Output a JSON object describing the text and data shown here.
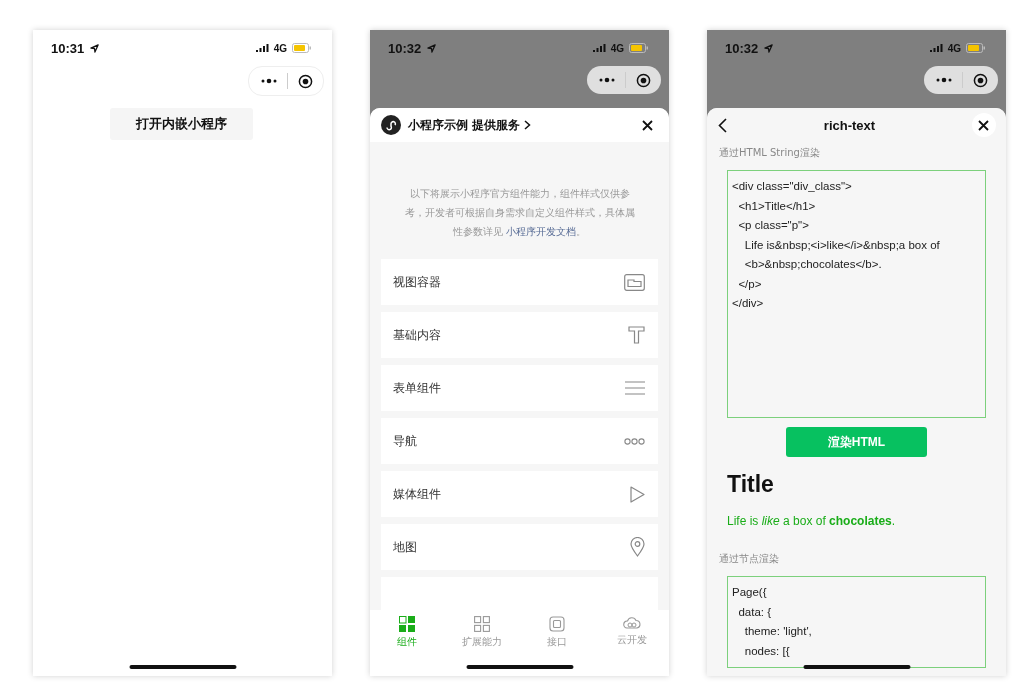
{
  "phones": [
    {
      "kind": "launcher",
      "dimmed": false,
      "time": "10:31",
      "network": "4G",
      "button": "打开内嵌小程序"
    },
    {
      "kind": "component_list",
      "dimmed": true,
      "time": "10:32",
      "network": "4G",
      "header_title": "小程序示例",
      "header_action": "提供服务",
      "intro": "以下将展示小程序官方组件能力，组件样式仅供参考，开发者可根据自身需求自定义组件样式，具体属性参数详见 ",
      "intro_link": "小程序开发文档",
      "intro_end": "。",
      "items": [
        {
          "label": "视图容器"
        },
        {
          "label": "基础内容"
        },
        {
          "label": "表单组件"
        },
        {
          "label": "导航"
        },
        {
          "label": "媒体组件"
        },
        {
          "label": "地图"
        }
      ],
      "tabs": [
        {
          "label": "组件",
          "selected": true
        },
        {
          "label": "扩展能力",
          "selected": false
        },
        {
          "label": "接口",
          "selected": false
        },
        {
          "label": "云开发",
          "selected": false
        }
      ]
    },
    {
      "kind": "rich_text",
      "dimmed": true,
      "time": "10:32",
      "network": "4G",
      "nav_title": "rich-text",
      "section_1": "通过HTML String渲染",
      "code_1": [
        "<div class=\"div_class\">",
        "  <h1>Title</h1>",
        "  <p class=\"p\">",
        "    Life is&nbsp;<i>like</i>&nbsp;a box of",
        "    <b>&nbsp;chocolates</b>.",
        "  </p>",
        "</div>"
      ],
      "button": "渲染HTML",
      "rendered_title": "Title",
      "rendered_text": "Life is *like* a box of **chocolates**.",
      "section_2": "通过节点渲染",
      "code_2": [
        "Page({",
        "  data: {",
        "    theme: 'light',",
        "    nodes: [{"
      ]
    }
  ]
}
